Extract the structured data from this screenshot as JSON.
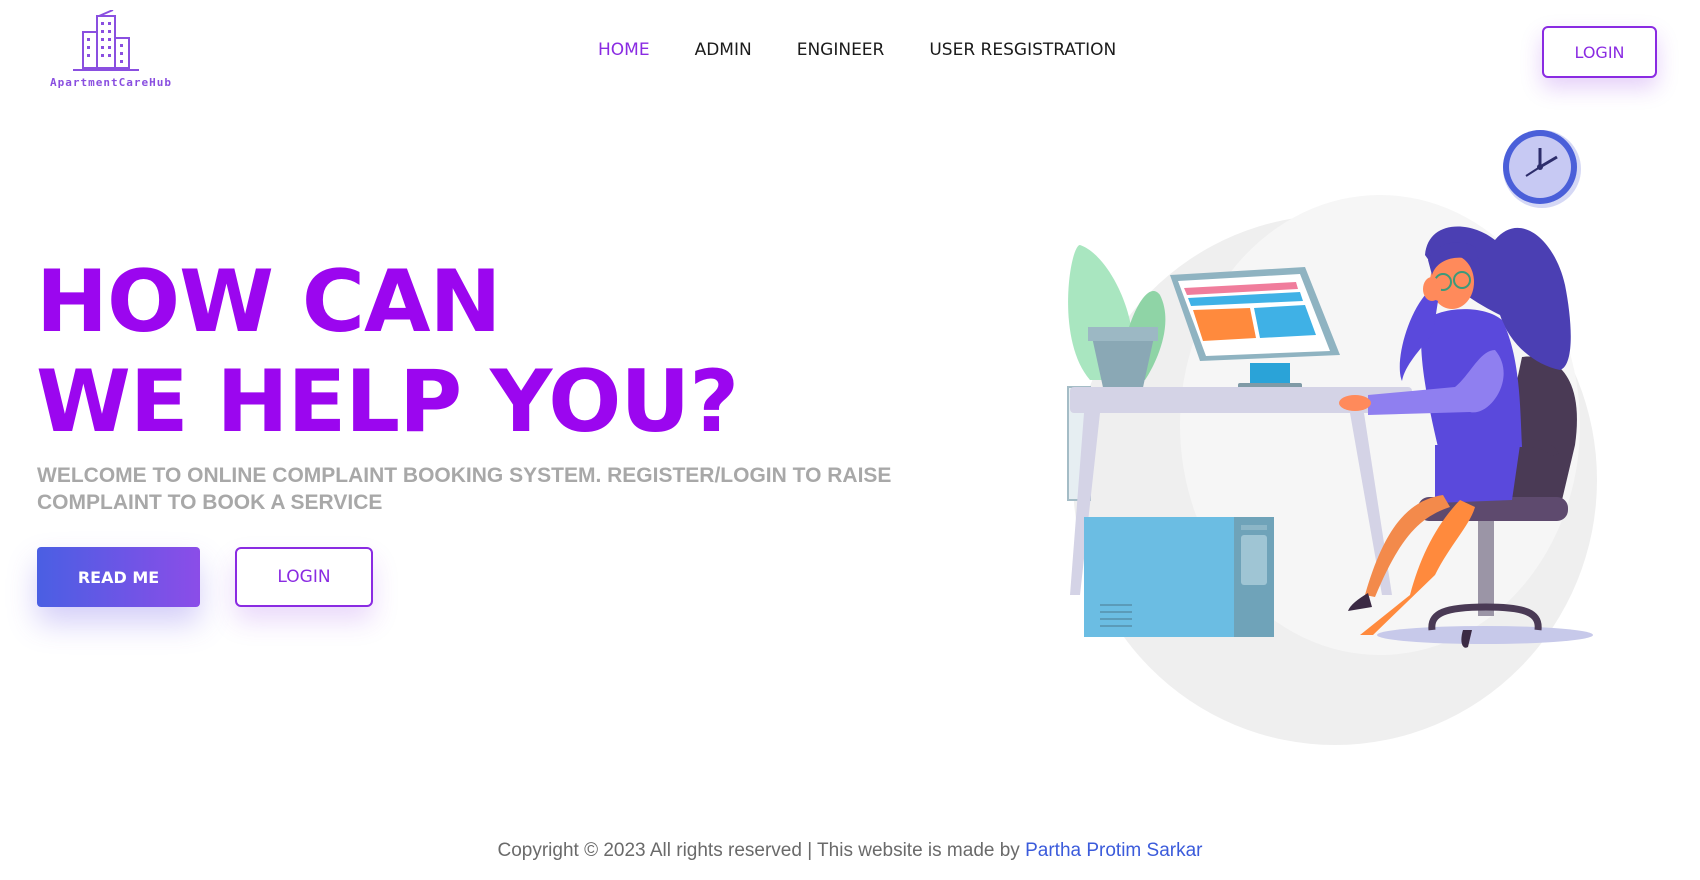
{
  "brand": {
    "name": "ApartmentCareHub",
    "accent_color": "#9b06ef",
    "button_gradient": [
      "#4a5fe3",
      "#8b4de8"
    ]
  },
  "nav": {
    "items": [
      {
        "label": "HOME",
        "active": true
      },
      {
        "label": "ADMIN",
        "active": false
      },
      {
        "label": "ENGINEER",
        "active": false
      },
      {
        "label": "USER RESGISTRATION",
        "active": false
      }
    ],
    "login_label": "LOGIN"
  },
  "hero": {
    "title_line1": "HOW CAN",
    "title_line2": "WE HELP YOU?",
    "subtitle": "WELCOME TO ONLINE COMPLAINT BOOKING SYSTEM. REGISTER/LOGIN TO RAISE COMPLAINT TO BOOK A SERVICE",
    "read_button": "READ ME",
    "login_button": "LOGIN"
  },
  "illustration": {
    "icon": "woman-at-desk-illustration"
  },
  "footer": {
    "copyright": "Copyright © 2023 All rights reserved | This website is made by ",
    "author": "Partha Protim Sarkar"
  }
}
